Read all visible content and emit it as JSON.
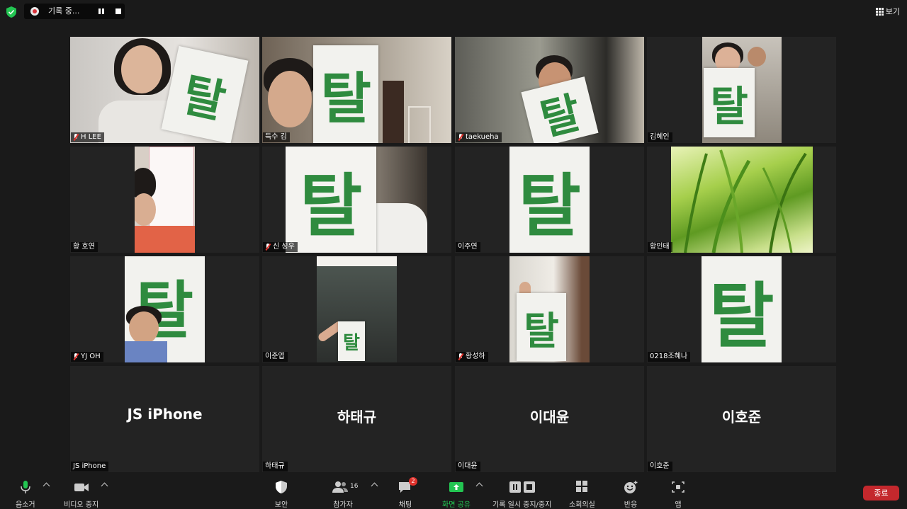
{
  "top_bar": {
    "recording_text": "기록 중...",
    "view_label": "보기"
  },
  "sign_char": "탈",
  "tiles": [
    {
      "name": "H LEE",
      "muted": true
    },
    {
      "name": "득수 김",
      "muted": false,
      "active": true
    },
    {
      "name": "taekueha",
      "muted": true
    },
    {
      "name": "김혜인",
      "muted": false
    },
    {
      "name": "황 호연",
      "muted": false
    },
    {
      "name": "신 성우",
      "muted": true
    },
    {
      "name": "이주연",
      "muted": false
    },
    {
      "name": "황인태",
      "muted": false
    },
    {
      "name": "YJ OH",
      "muted": true
    },
    {
      "name": "이준엽",
      "muted": false
    },
    {
      "name": "황성하",
      "muted": true
    },
    {
      "name": "0218조혜나",
      "muted": false
    },
    {
      "name": "JS iPhone",
      "display": "JS iPhone"
    },
    {
      "name": "하태규",
      "display": "하태규"
    },
    {
      "name": "이대윤",
      "display": "이대윤"
    },
    {
      "name": "이호준",
      "display": "이호준"
    }
  ],
  "toolbar": {
    "mute": "음소거",
    "video": "비디오 중지",
    "security": "보안",
    "participants": "참가자",
    "participants_count": "16",
    "chat": "채팅",
    "chat_badge": "2",
    "share": "화면 공유",
    "recording": "기록 일시 중지/중지",
    "breakout": "소회의실",
    "reactions": "반응",
    "apps": "앱",
    "end": "종료"
  },
  "colors": {
    "background": "#1a1a1a",
    "tile": "#232323",
    "active_border": "#d5e57a",
    "sign_green": "#2f8b3f",
    "end_red": "#c4282d",
    "share_green": "#23c552"
  }
}
